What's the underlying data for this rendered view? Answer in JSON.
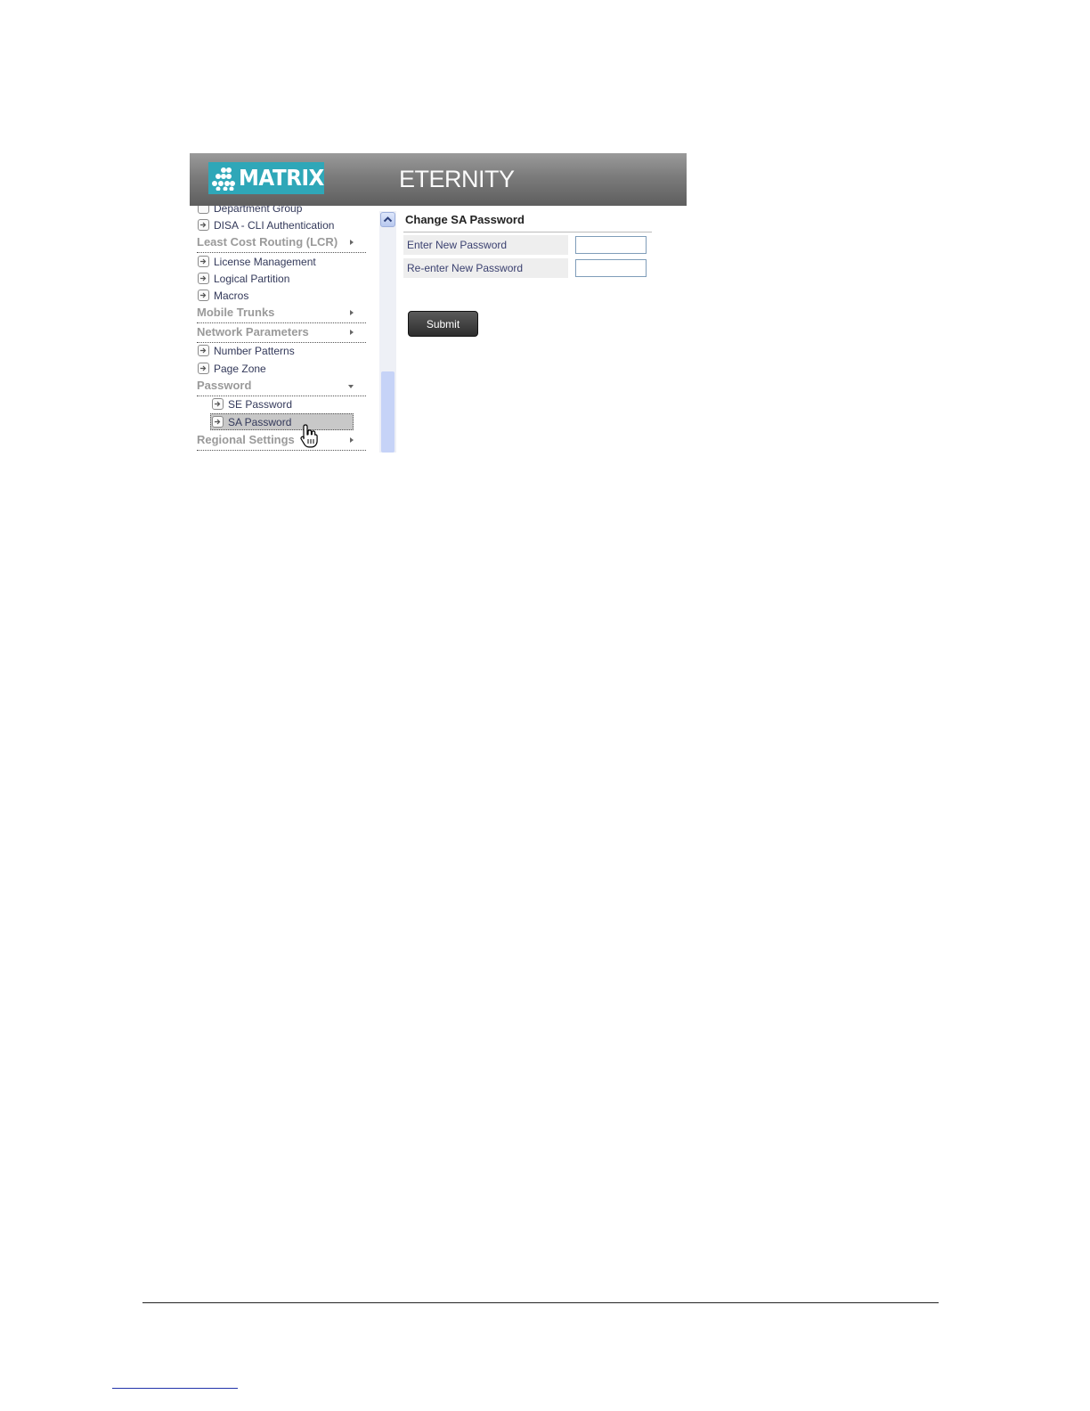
{
  "header": {
    "brand": "MATRIX",
    "product": "ETERNITY",
    "colors": {
      "logo_bg": "#2fa7b8",
      "bar": "#7b7b7b"
    }
  },
  "menu": {
    "partial_top": "Department Group",
    "items": [
      {
        "label": "DISA - CLI Authentication",
        "type": "page"
      },
      {
        "label": "Least Cost Routing (LCR)",
        "type": "category",
        "arrow": "right"
      },
      {
        "label": "License Management",
        "type": "page"
      },
      {
        "label": "Logical Partition",
        "type": "page"
      },
      {
        "label": "Macros",
        "type": "page"
      },
      {
        "label": "Mobile Trunks",
        "type": "category",
        "arrow": "right"
      },
      {
        "label": "Network Parameters",
        "type": "category",
        "arrow": "right"
      },
      {
        "label": "Number Patterns",
        "type": "page"
      },
      {
        "label": "Page Zone",
        "type": "page"
      },
      {
        "label": "Password",
        "type": "category",
        "arrow": "down"
      },
      {
        "label": "SE Password",
        "type": "subpage"
      },
      {
        "label": "SA Password",
        "type": "subpage",
        "selected": true
      },
      {
        "label": "Regional Settings",
        "type": "category",
        "arrow": "right"
      }
    ]
  },
  "form": {
    "title": "Change SA Password",
    "fields": [
      {
        "label": "Enter New Password",
        "value": ""
      },
      {
        "label": "Re-enter New Password",
        "value": ""
      }
    ],
    "submit_label": "Submit"
  }
}
